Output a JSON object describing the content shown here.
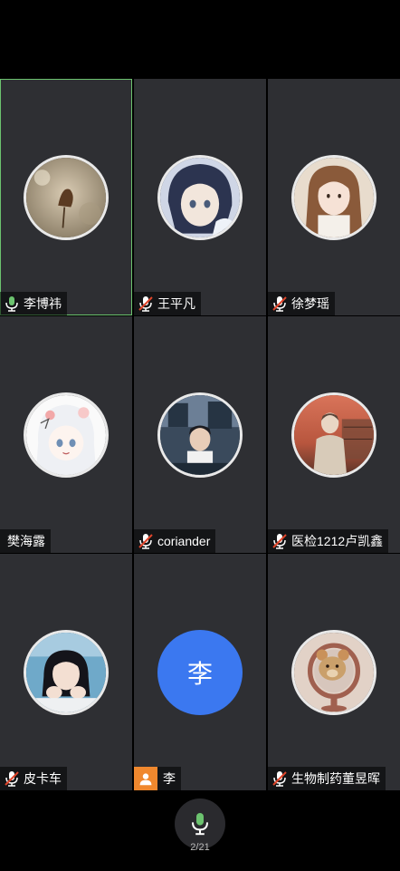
{
  "participants": [
    {
      "name": "李博祎",
      "mic": "on"
    },
    {
      "name": "王平凡",
      "mic": "muted"
    },
    {
      "name": "徐梦瑶",
      "mic": "muted"
    },
    {
      "name": "樊海露",
      "mic": "none"
    },
    {
      "name": "coriander",
      "mic": "muted"
    },
    {
      "name": "医检1212卢凯鑫",
      "mic": "muted"
    },
    {
      "name": "皮卡车",
      "mic": "muted"
    },
    {
      "name": "李",
      "mic": "person",
      "initial": "李"
    },
    {
      "name": "生物制药董昱晖",
      "mic": "muted"
    }
  ],
  "colors": {
    "tile_bg": "#2e2f33",
    "active_border": "#6cc36f",
    "mic_on": "#6cc36f",
    "mic_muted_slash": "#e0452b",
    "letter_avatar_bg": "#3b78f0",
    "person_badge": "#f0882e"
  },
  "footer": {
    "mic_button_icon": "microphone-icon",
    "page_indicator": "2/21"
  }
}
